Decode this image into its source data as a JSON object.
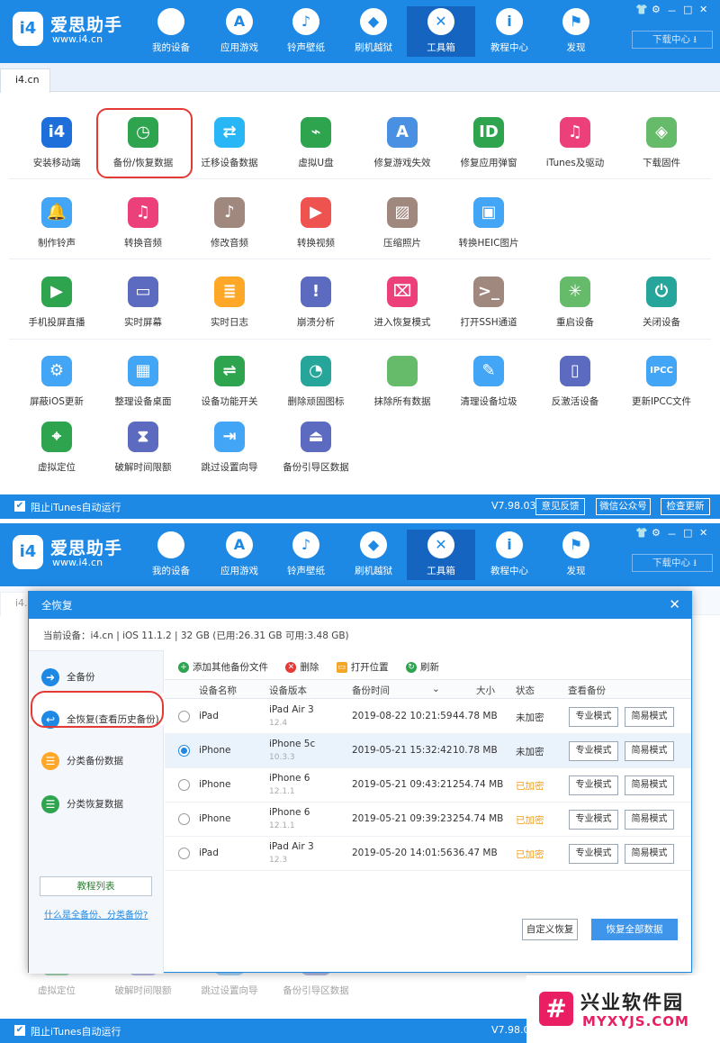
{
  "app": {
    "brand": "爱思助手",
    "site": "www.i4.cn",
    "logo_text": "i4",
    "window_controls": [
      "👕",
      "⚙",
      "－",
      "□",
      "✕"
    ],
    "download_center": "下载中心"
  },
  "nav": [
    {
      "label": "我的设备",
      "icon": "apple-icon",
      "glyph": ""
    },
    {
      "label": "应用游戏",
      "icon": "app-store-icon",
      "glyph": "A"
    },
    {
      "label": "铃声壁纸",
      "icon": "wallpaper-icon",
      "glyph": "♪"
    },
    {
      "label": "刷机越狱",
      "icon": "dropbox-icon",
      "glyph": "◆"
    },
    {
      "label": "工具箱",
      "icon": "tools-icon",
      "glyph": "✕"
    },
    {
      "label": "教程中心",
      "icon": "info-icon",
      "glyph": "i"
    },
    {
      "label": "发现",
      "icon": "flag-icon",
      "glyph": "⚑"
    }
  ],
  "tab": "i4.cn",
  "tools": [
    {
      "label": "安装移动端",
      "color": "#1e6fd9",
      "glyph": "i4",
      "icon": "i4-icon"
    },
    {
      "label": "备份/恢复数据",
      "color": "#2ea44f",
      "glyph": "◷",
      "icon": "backup-icon"
    },
    {
      "label": "迁移设备数据",
      "color": "#29b6f6",
      "glyph": "⇄",
      "icon": "migrate-icon"
    },
    {
      "label": "虚拟U盘",
      "color": "#2ea44f",
      "glyph": "⌁",
      "icon": "usb-icon"
    },
    {
      "label": "修复游戏失效",
      "color": "#4a90e2",
      "glyph": "A",
      "icon": "fix-game-icon"
    },
    {
      "label": "修复应用弹窗",
      "color": "#2ea44f",
      "glyph": "ID",
      "icon": "apple-id-icon"
    },
    {
      "label": "iTunes及驱动",
      "color": "#ec407a",
      "glyph": "♫",
      "icon": "itunes-icon"
    },
    {
      "label": "下载固件",
      "color": "#66bb6a",
      "glyph": "◈",
      "icon": "firmware-icon"
    },
    {
      "label": "制作铃声",
      "color": "#42a5f5",
      "glyph": "🔔",
      "icon": "bell-icon"
    },
    {
      "label": "转换音频",
      "color": "#ec407a",
      "glyph": "♫",
      "icon": "convert-audio-icon"
    },
    {
      "label": "修改音频",
      "color": "#a1887f",
      "glyph": "♪",
      "icon": "edit-audio-icon"
    },
    {
      "label": "转换视频",
      "color": "#ef5350",
      "glyph": "▶",
      "icon": "convert-video-icon"
    },
    {
      "label": "压缩照片",
      "color": "#a1887f",
      "glyph": "▨",
      "icon": "photo-icon"
    },
    {
      "label": "转换HEIC图片",
      "color": "#42a5f5",
      "glyph": "▣",
      "icon": "heic-icon"
    },
    {
      "label": "手机投屏直播",
      "color": "#2ea44f",
      "glyph": "▶",
      "icon": "screen-cast-icon"
    },
    {
      "label": "实时屏幕",
      "color": "#5c6bc0",
      "glyph": "▭",
      "icon": "monitor-icon"
    },
    {
      "label": "实时日志",
      "color": "#ffa726",
      "glyph": "≣",
      "icon": "log-icon"
    },
    {
      "label": "崩溃分析",
      "color": "#5c6bc0",
      "glyph": "!",
      "icon": "crash-icon"
    },
    {
      "label": "进入恢复模式",
      "color": "#ec407a",
      "glyph": "⌧",
      "icon": "recovery-icon"
    },
    {
      "label": "打开SSH通道",
      "color": "#a1887f",
      "glyph": ">_",
      "icon": "ssh-icon"
    },
    {
      "label": "重启设备",
      "color": "#66bb6a",
      "glyph": "✳",
      "icon": "restart-icon"
    },
    {
      "label": "关闭设备",
      "color": "#26a69a",
      "glyph": "⏻",
      "icon": "power-icon"
    },
    {
      "label": "屏蔽iOS更新",
      "color": "#42a5f5",
      "glyph": "⚙",
      "icon": "block-update-icon"
    },
    {
      "label": "整理设备桌面",
      "color": "#42a5f5",
      "glyph": "▦",
      "icon": "desktop-icon"
    },
    {
      "label": "设备功能开关",
      "color": "#2ea44f",
      "glyph": "⇌",
      "icon": "toggle-icon"
    },
    {
      "label": "删除顽固图标",
      "color": "#26a69a",
      "glyph": "◔",
      "icon": "delete-icon-icon"
    },
    {
      "label": "抹除所有数据",
      "color": "#66bb6a",
      "glyph": "",
      "icon": "erase-icon"
    },
    {
      "label": "清理设备垃圾",
      "color": "#42a5f5",
      "glyph": "✎",
      "icon": "clean-icon"
    },
    {
      "label": "反激活设备",
      "color": "#5c6bc0",
      "glyph": "▯",
      "icon": "deactivate-icon"
    },
    {
      "label": "更新IPCC文件",
      "color": "#42a5f5",
      "glyph": "IPCC",
      "icon": "ipcc-icon"
    },
    {
      "label": "虚拟定位",
      "color": "#2ea44f",
      "glyph": "⌖",
      "icon": "location-icon"
    },
    {
      "label": "破解时间限额",
      "color": "#5c6bc0",
      "glyph": "⧗",
      "icon": "time-limit-icon"
    },
    {
      "label": "跳过设置向导",
      "color": "#42a5f5",
      "glyph": "⇥",
      "icon": "skip-setup-icon"
    },
    {
      "label": "备份引导区数据",
      "color": "#5c6bc0",
      "glyph": "⏏",
      "icon": "boot-backup-icon"
    }
  ],
  "footer": {
    "checkbox": "阻止iTunes自动运行",
    "version": "V7.98.03",
    "feedback": "意见反馈",
    "wechat": "微信公众号",
    "check_update": "检查更新",
    "check_glyph": "✔"
  },
  "dialog": {
    "title": "全恢复",
    "close": "✕",
    "device_info": "当前设备：i4.cn  |  iOS 11.1.2  |  32 GB (已用:26.31 GB 可用:3.48 GB)",
    "side": [
      {
        "label": "全备份",
        "color": "#1e88e5",
        "glyph": "➜"
      },
      {
        "label": "全恢复(查看历史备份)",
        "color": "#1e88e5",
        "glyph": "↩"
      },
      {
        "label": "分类备份数据",
        "color": "#ffa726",
        "glyph": "☰"
      },
      {
        "label": "分类恢复数据",
        "color": "#2ea44f",
        "glyph": "☰"
      }
    ],
    "tutorial": "教程列表",
    "what_link": "什么是全备份、分类备份?",
    "toolbar": [
      {
        "label": "添加其他备份文件",
        "color": "#2ea44f",
        "glyph": "+"
      },
      {
        "label": "删除",
        "color": "#e53935",
        "glyph": "✕"
      },
      {
        "label": "打开位置",
        "color": "#f5a623",
        "glyph": "▭"
      },
      {
        "label": "刷新",
        "color": "#2ea44f",
        "glyph": "↻"
      }
    ],
    "columns": [
      "设备名称",
      "设备版本",
      "备份时间",
      "大小",
      "状态",
      "查看备份"
    ],
    "sort_glyph": "⌄",
    "rows": [
      {
        "name": "iPad",
        "model": "iPad Air 3",
        "ver": "12.4",
        "time": "2019-08-22 10:21:59",
        "size": "44.78 MB",
        "status": "未加密",
        "encrypted": false,
        "selected": false
      },
      {
        "name": "iPhone",
        "model": "iPhone 5c",
        "ver": "10.3.3",
        "time": "2019-05-21 15:32:42",
        "size": "10.78 MB",
        "status": "未加密",
        "encrypted": false,
        "selected": true
      },
      {
        "name": "iPhone",
        "model": "iPhone 6",
        "ver": "12.1.1",
        "time": "2019-05-21 09:43:21",
        "size": "254.74 MB",
        "status": "已加密",
        "encrypted": true,
        "selected": false
      },
      {
        "name": "iPhone",
        "model": "iPhone 6",
        "ver": "12.1.1",
        "time": "2019-05-21 09:39:23",
        "size": "254.74 MB",
        "status": "已加密",
        "encrypted": true,
        "selected": false
      },
      {
        "name": "iPad",
        "model": "iPad Air 3",
        "ver": "12.3",
        "time": "2019-05-20 14:01:56",
        "size": "36.47 MB",
        "status": "已加密",
        "encrypted": true,
        "selected": false
      }
    ],
    "btn_pro": "专业模式",
    "btn_simple": "简易模式",
    "custom_restore": "自定义恢复",
    "restore_all": "恢复全部数据"
  },
  "watermark": {
    "logo": "#",
    "title": "兴业软件园",
    "url": "MYXYJS.COM"
  }
}
